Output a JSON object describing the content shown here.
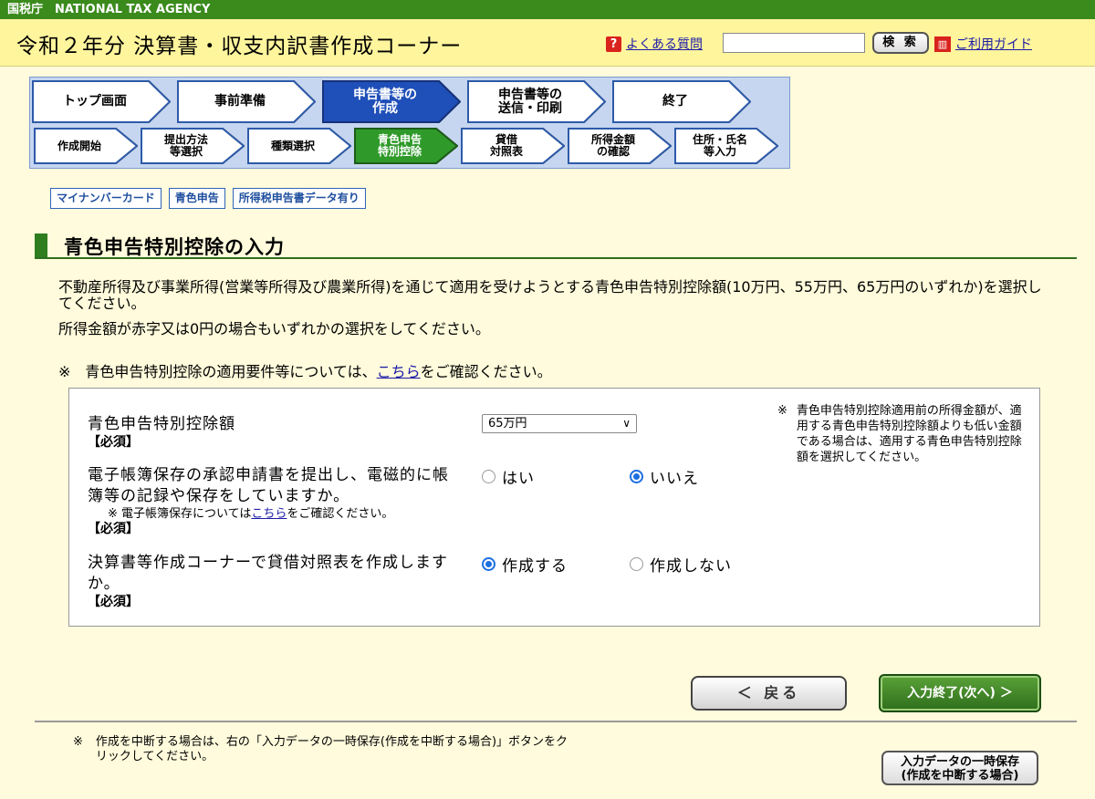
{
  "agency_bar": "国税庁　NATIONAL TAX AGENCY",
  "header": {
    "title": "令和２年分 決算書・収支内訳書作成コーナー",
    "faq_link": "よくある質問",
    "search_value": "",
    "search_button": "検 索",
    "guide_link": "ご利用ガイド"
  },
  "steps_main": [
    {
      "label": "トップ画面",
      "state": "done"
    },
    {
      "label": "事前準備",
      "state": "done"
    },
    {
      "label": "申告書等の\n作成",
      "state": "current"
    },
    {
      "label": "申告書等の\n送信・印刷",
      "state": "todo"
    },
    {
      "label": "終了",
      "state": "todo"
    }
  ],
  "steps_sub": [
    {
      "label": "作成開始",
      "state": "done"
    },
    {
      "label": "提出方法\n等選択",
      "state": "done"
    },
    {
      "label": "種類選択",
      "state": "done"
    },
    {
      "label": "青色申告\n特別控除",
      "state": "current"
    },
    {
      "label": "貸借\n対照表",
      "state": "todo"
    },
    {
      "label": "所得金額\nの確認",
      "state": "todo"
    },
    {
      "label": "住所・氏名\n等入力",
      "state": "todo"
    }
  ],
  "badges": [
    "マイナンバーカード",
    "青色申告",
    "所得税申告書データ有り"
  ],
  "section_title": "青色申告特別控除の入力",
  "intro": {
    "p1": "不動産所得及び事業所得(営業等所得及び農業所得)を通じて適用を受けようとする青色申告特別控除額(10万円、55万円、65万円のいずれか)を選択してください。",
    "p2": "所得金額が赤字又は0円の場合もいずれかの選択をしてください。",
    "note_prefix": "※　青色申告特別控除の適用要件等については、",
    "note_link": "こちら",
    "note_suffix": "をご確認ください。"
  },
  "form": {
    "q1": {
      "label": "青色申告特別控除額",
      "required": "【必須】",
      "selected": "65万円"
    },
    "q2": {
      "label": "電子帳簿保存の承認申請書を提出し、電磁的に帳簿等の記録や保存をしていますか。",
      "note_prefix": "※ 電子帳簿保存については",
      "note_link": "こちら",
      "note_suffix": "をご確認ください。",
      "required": "【必須】",
      "opt_yes": "はい",
      "opt_no": "いいえ",
      "selected": "いいえ"
    },
    "q3": {
      "label": "決算書等作成コーナーで貸借対照表を作成しますか。",
      "required": "【必須】",
      "opt_create": "作成する",
      "opt_not": "作成しない",
      "selected": "作成する"
    },
    "side_note_mark": "※",
    "side_note": "青色申告特別控除適用前の所得金額が、適用する青色申告特別控除額よりも低い金額である場合は、適用する青色申告特別控除額を選択してください。"
  },
  "buttons": {
    "back": "＜ 戻る",
    "next": "入力終了(次へ) ＞",
    "save": "入力データの一時保存\n(作成を中断する場合)"
  },
  "footer": {
    "mark": "※",
    "note": "作成を中断する場合は、右の「入力データの一時保存(作成を中断する場合)」ボタンをクリックしてください。"
  },
  "colors": {
    "agency_green": "#3a8a1c",
    "header_yellow": "#fff59d",
    "page_bg": "#fffbdc",
    "step_done": "#ffffff",
    "step_current": "#1f4fb8",
    "sub_current": "#2f9a2a",
    "radio_blue": "#1d6fe0"
  }
}
